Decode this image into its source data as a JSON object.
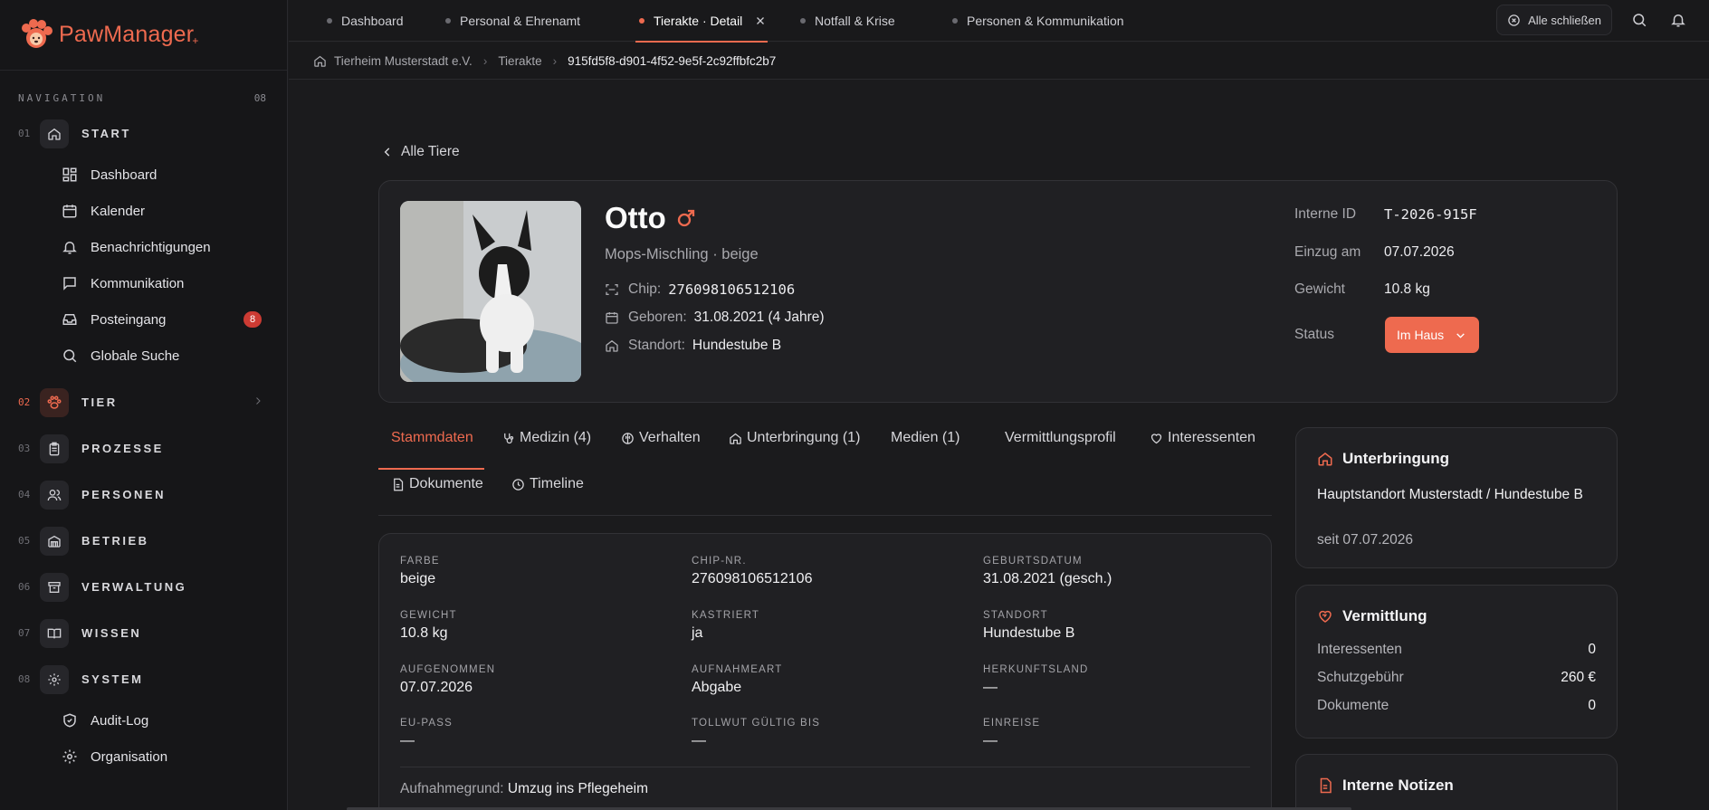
{
  "brand": {
    "name": "PawManager",
    "plus": "+"
  },
  "nav": {
    "heading": "NAVIGATION",
    "count": "08",
    "sections": [
      {
        "num": "01",
        "label": "START",
        "icon": "home-icon"
      },
      {
        "num": "02",
        "label": "TIER",
        "icon": "paw-icon"
      },
      {
        "num": "03",
        "label": "PROZESSE",
        "icon": "clipboard-icon"
      },
      {
        "num": "04",
        "label": "PERSONEN",
        "icon": "users-icon"
      },
      {
        "num": "05",
        "label": "BETRIEB",
        "icon": "building-icon"
      },
      {
        "num": "06",
        "label": "VERWALTUNG",
        "icon": "archive-icon"
      },
      {
        "num": "07",
        "label": "WISSEN",
        "icon": "book-icon"
      },
      {
        "num": "08",
        "label": "SYSTEM",
        "icon": "gear-icon"
      }
    ],
    "start_items": [
      "Dashboard",
      "Kalender",
      "Benachrichtigungen",
      "Kommunikation",
      "Posteingang",
      "Globale Suche"
    ],
    "posteingang_badge": "8",
    "system_items": [
      "Audit-Log",
      "Organisation"
    ]
  },
  "tabs": [
    "Dashboard",
    "Personal & Ehrenamt",
    "Tierakte · Detail",
    "Notfall & Krise",
    "Personen & Kommunikation"
  ],
  "close_all": "Alle schließen",
  "breadcrumb": [
    "Tierheim Musterstadt e.V.",
    "Tierakte",
    "915fd5f8-d901-4f52-9e5f-2c92ffbfc2b7"
  ],
  "back": "Alle Tiere",
  "animal": {
    "name": "Otto",
    "breed": "Mops-Mischling · beige",
    "chip_label": "Chip:",
    "chip": "276098106512106",
    "born_label": "Geboren:",
    "born": "31.08.2021 (4 Jahre)",
    "loc_label": "Standort:",
    "loc": "Hundestube B",
    "id_label": "Interne ID",
    "id": "T-2026-915F",
    "in_label": "Einzug am",
    "in": "07.07.2026",
    "weight_label": "Gewicht",
    "weight": "10.8 kg",
    "status_label": "Status",
    "status": "Im Haus"
  },
  "detail_tabs": [
    "Stammdaten",
    "Medizin (4)",
    "Verhalten",
    "Unterbringung (1)",
    "Medien (1)",
    "Vermittlungsprofil",
    "Interessenten",
    "Dokumente",
    "Timeline"
  ],
  "fields": {
    "farbe": {
      "k": "FARBE",
      "v": "beige"
    },
    "chip": {
      "k": "CHIP-NR.",
      "v": "276098106512106"
    },
    "geb": {
      "k": "GEBURTSDATUM",
      "v": "31.08.2021 (gesch.)"
    },
    "gewicht": {
      "k": "GEWICHT",
      "v": "10.8 kg"
    },
    "kastriert": {
      "k": "KASTRIERT",
      "v": "ja"
    },
    "standort": {
      "k": "STANDORT",
      "v": "Hundestube B"
    },
    "aufgenommen": {
      "k": "AUFGENOMMEN",
      "v": "07.07.2026"
    },
    "aufnahmeart": {
      "k": "AUFNAHMEART",
      "v": "Abgabe"
    },
    "herkunft": {
      "k": "HERKUNFTSLAND",
      "v": "—"
    },
    "eupass": {
      "k": "EU-PASS",
      "v": "—"
    },
    "tollwut": {
      "k": "TOLLWUT GÜLTIG BIS",
      "v": "—"
    },
    "einreise": {
      "k": "EINREISE",
      "v": "—"
    }
  },
  "reason": {
    "label": "Aufnahmegrund:",
    "value": "Umzug ins Pflegeheim"
  },
  "unterbringung": {
    "title": "Unterbringung",
    "place": "Hauptstandort Musterstadt / Hundestube B",
    "since": "seit 07.07.2026"
  },
  "vermittlung": {
    "title": "Vermittlung",
    "rows": [
      {
        "k": "Interessenten",
        "v": "0"
      },
      {
        "k": "Schutzgebühr",
        "v": "260 €"
      },
      {
        "k": "Dokumente",
        "v": "0"
      }
    ]
  },
  "notizen": {
    "title": "Interne Notizen"
  }
}
